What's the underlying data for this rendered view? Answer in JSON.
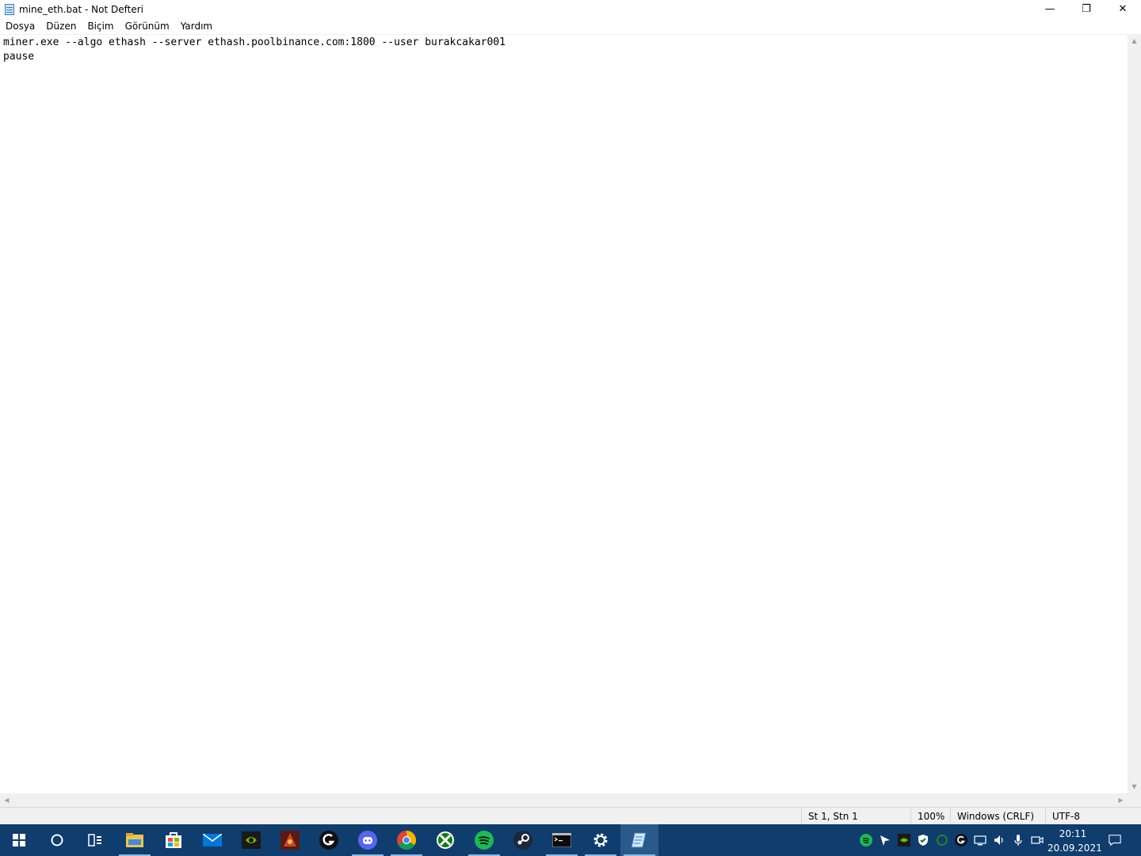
{
  "window": {
    "title": "mine_eth.bat - Not Defteri",
    "minimize": "—",
    "restore": "❐",
    "close": "✕"
  },
  "menu": {
    "items": [
      {
        "label": "Dosya"
      },
      {
        "label": "Düzen"
      },
      {
        "label": "Biçim"
      },
      {
        "label": "Görünüm"
      },
      {
        "label": "Yardım"
      }
    ]
  },
  "editor": {
    "lines": [
      "miner.exe --algo ethash --server ethash.poolbinance.com:1800 --user burakcakar001",
      "pause"
    ]
  },
  "status": {
    "position": "St 1, Stn 1",
    "zoom": "100%",
    "line_ending": "Windows (CRLF)",
    "encoding": "UTF-8"
  },
  "taskbar": {
    "apps": [
      {
        "name": "start-icon"
      },
      {
        "name": "search-icon"
      },
      {
        "name": "task-view-icon"
      },
      {
        "name": "file-explorer-icon"
      },
      {
        "name": "store-icon"
      },
      {
        "name": "mail-icon"
      },
      {
        "name": "nvidia-icon"
      },
      {
        "name": "game-icon"
      },
      {
        "name": "logitech-icon"
      },
      {
        "name": "discord-icon"
      },
      {
        "name": "chrome-icon"
      },
      {
        "name": "xbox-icon"
      },
      {
        "name": "spotify-icon"
      },
      {
        "name": "steam-icon"
      },
      {
        "name": "terminal-icon"
      },
      {
        "name": "settings-icon"
      },
      {
        "name": "notepad-icon"
      }
    ],
    "clock_time": "20:11",
    "clock_date": "20.09.2021"
  }
}
